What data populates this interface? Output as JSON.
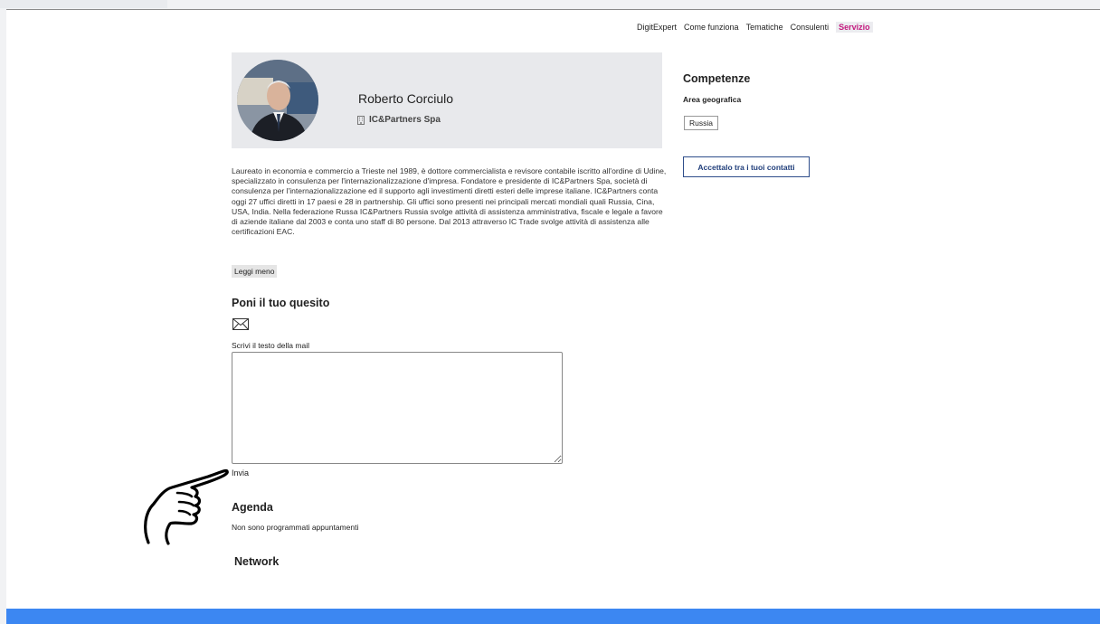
{
  "nav": {
    "items": [
      {
        "label": "DigitExpert",
        "active": false
      },
      {
        "label": "Come funziona",
        "active": false
      },
      {
        "label": "Tematiche",
        "active": false
      },
      {
        "label": "Consulenti",
        "active": false
      },
      {
        "label": "Servizio",
        "active": true
      }
    ]
  },
  "profile": {
    "name": "Roberto Corciulo",
    "company": "IC&Partners Spa",
    "company_icon": "building-icon",
    "bio": " Laureato in economia e commercio a Trieste nel 1989, è dottore commercialista e revisore contabile iscritto all'ordine di Udine, specializzato in consulenza per l'internazionalizzazione d'impresa.  Fondatore e presidente di IC&Partners Spa, società di consulenza per l'internazionalizzazione ed il supporto agli investimenti diretti esteri delle imprese italiane. IC&Partners conta oggi 27 uffici diretti in 17 paesi  e 28 in partnership. Gli uffici sono presenti nei principali mercati mondiali quali Russia, Cina, USA, India. Nella federazione Russa IC&Partners Russia svolge attività di assistenza amministrativa, fiscale e legale a favore di aziende italiane dal 2003 e conta uno staff di 80 persone. Dal 2013 attraverso IC Trade svolge attività di assistenza alle certificazioni EAC.",
    "read_less": "Leggi meno"
  },
  "question": {
    "title": "Poni il tuo quesito",
    "icon": "envelope-icon",
    "mail_label": "Scrivi il testo della mail",
    "mail_value": "",
    "send_label": "Invia"
  },
  "agenda": {
    "title": "Agenda",
    "empty_text": "Non sono programmati appuntamenti"
  },
  "network": {
    "title": "Network"
  },
  "skills": {
    "title": "Competenze",
    "geo_label": "Area geografica",
    "tags": [
      "Russia"
    ],
    "accept_label": "Accettalo tra i tuoi contatti"
  },
  "colors": {
    "accent_active": "#c4197e",
    "footer": "#3c87f2",
    "accept_button_text": "#1f3d7a",
    "card_background": "#e8e9ec"
  },
  "overlay": {
    "cursor_icon": "hand-pointer-icon"
  }
}
